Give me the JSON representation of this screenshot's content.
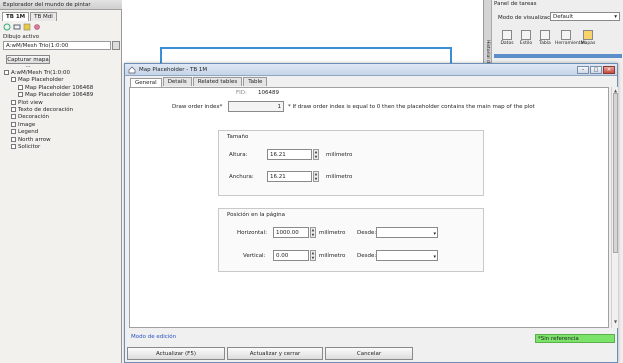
{
  "explorer": {
    "title": "Explorador del mundo de pintar",
    "tabs": [
      "TB 1M",
      "TB Mdl"
    ],
    "active_label": "Dibujo activo",
    "active_value": "A:wM/Mesh Trio(1:0:00",
    "capture_btn": "Capturar mapa ...",
    "tree": [
      {
        "label": "A:wM/Mesh Tri(1:0:00",
        "indent": 0
      },
      {
        "label": "Map Placeholder",
        "indent": 1
      },
      {
        "label": "Map Placeholder 106468",
        "indent": 2
      },
      {
        "label": "Map Placeholder 106489",
        "indent": 2
      },
      {
        "label": "Plot view",
        "indent": 1
      },
      {
        "label": "Texto de decoración",
        "indent": 1
      },
      {
        "label": "Decoración",
        "indent": 1
      },
      {
        "label": "Image",
        "indent": 1
      },
      {
        "label": "Legend",
        "indent": 1
      },
      {
        "label": "North arrow",
        "indent": 1
      },
      {
        "label": "Solicitor",
        "indent": 1
      }
    ]
  },
  "taskpanel": {
    "title": "Panel de tareas",
    "mode_label": "Modo de visualización:",
    "mode_value": "Default",
    "tools": [
      "Datos",
      "Estilo",
      "Tabla",
      "Herramientas",
      "Mapas"
    ],
    "side_label": "Historial de acción"
  },
  "dialog": {
    "title": "Map Placeholder - TB 1M",
    "tabs": [
      "General",
      "Details",
      "Related tables",
      "Table"
    ],
    "fid_label": "FID:",
    "fid_value": "106489",
    "draw_order_label": "Draw order index*",
    "draw_order_value": "1",
    "draw_order_note": "* If draw order index is equal to 0 then the placeholder contains the main map of the plot",
    "size_group": "Tamaño",
    "height_label": "Altura:",
    "height_value": "16.21",
    "width_label": "Anchura:",
    "width_value": "16.21",
    "unit": "milímetro",
    "position_group": "Posición en la página",
    "horizontal_label": "Horizontal:",
    "horizontal_value": "1000.00",
    "vertical_label": "Vertical:",
    "vertical_value": "0.00",
    "from_label": "Desde:",
    "mode_text": "Modo de edición",
    "reference": "*Sin referencia",
    "buttons": [
      "Actualizar (F5)",
      "Actualizar y cerrar",
      "Cancelar"
    ]
  }
}
